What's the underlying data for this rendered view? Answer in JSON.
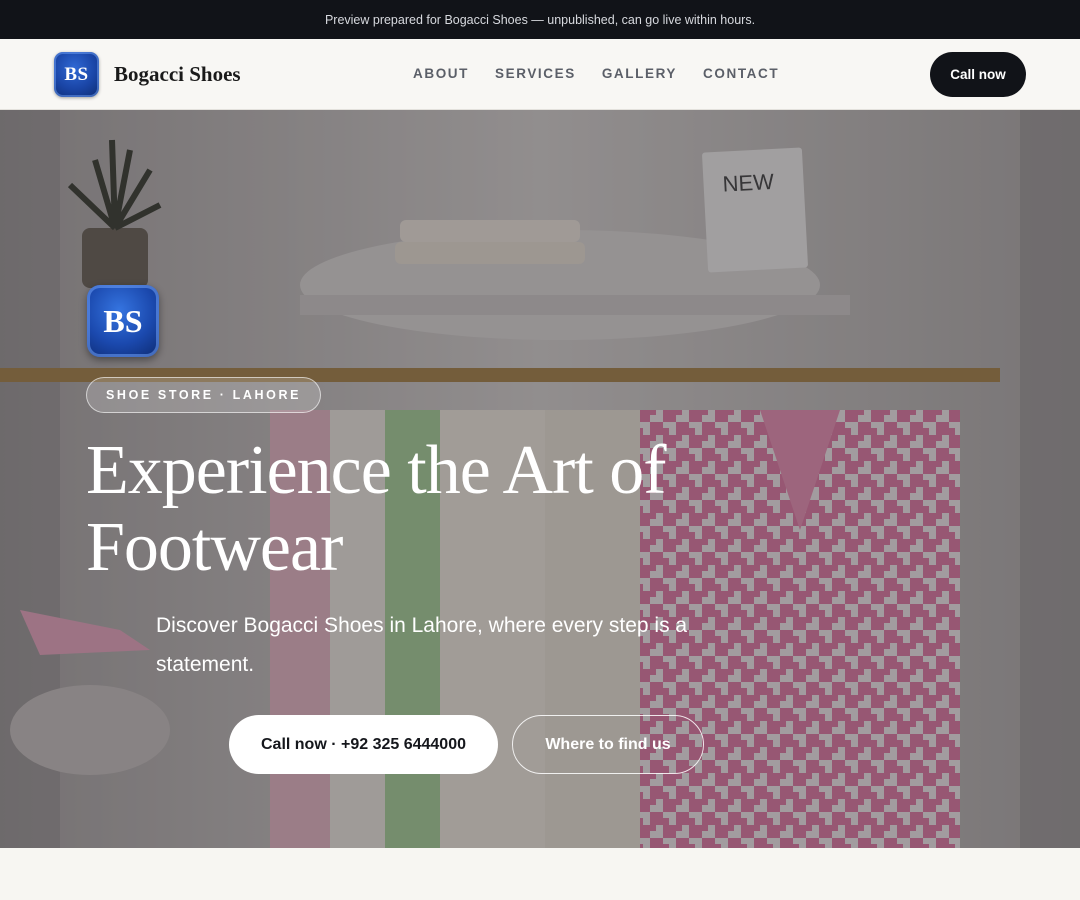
{
  "banner": {
    "text": "Preview prepared for Bogacci Shoes — unpublished, can go live within hours."
  },
  "nav": {
    "logo_text": "BS",
    "brand_name": "Bogacci Shoes",
    "links": [
      "ABOUT",
      "SERVICES",
      "GALLERY",
      "CONTACT"
    ],
    "cta_label": "Call now"
  },
  "hero": {
    "logo_text": "BS",
    "badge": "SHOE STORE · LAHORE",
    "headline": "Experience the Art of Footwear",
    "subtitle": "Discover Bogacci Shoes in Lahore, where every step is a statement.",
    "primary_button": "Call now · +92 325 6444000",
    "secondary_button": "Where to find us",
    "sign_text": "NEW"
  },
  "colors": {
    "dark": "#111318",
    "logo_blue": "#1a45a6",
    "accent_pink": "#d9709b"
  }
}
